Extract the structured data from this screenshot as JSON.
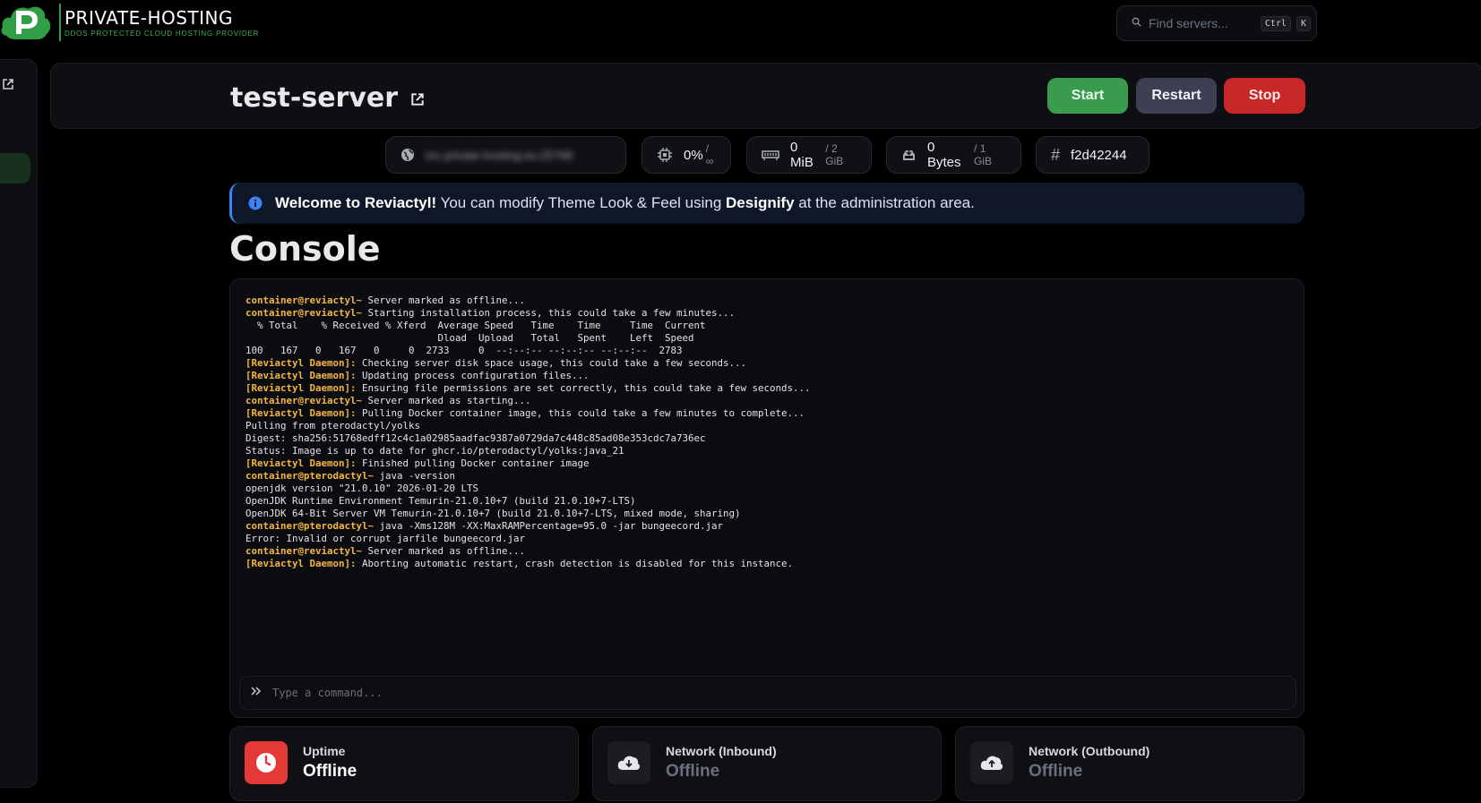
{
  "brand": {
    "title": "PRIVATE-HOSTING",
    "subtitle": "DDOS PROTECTED CLOUD HOSTING PROVIDER",
    "accent": "#2f9e44"
  },
  "search": {
    "placeholder": "Find servers...",
    "shortcut_ctrl": "Ctrl",
    "shortcut_key": "K"
  },
  "server": {
    "name": "test-server"
  },
  "controls": {
    "start": "Start",
    "restart": "Restart",
    "stop": "Stop"
  },
  "stats": {
    "address": "mc.private-hosting.eu:25768",
    "cpu": "0%",
    "cpu_limit": "/ ∞",
    "memory": "0 MiB",
    "memory_limit": "/ 2 GiB",
    "disk": "0 Bytes",
    "disk_limit": "/ 1 GiB",
    "id": "f2d42244"
  },
  "notice": {
    "lead": "Welcome to Reviactyl!",
    "text_1": " You can modify Theme Look & Feel using ",
    "highlight": "Designify",
    "text_2": " at the administration area."
  },
  "console": {
    "heading": "Console",
    "input_placeholder": "Type a command...",
    "lines": [
      {
        "prefix": "container@reviactyl~",
        "text": " Server marked as offline..."
      },
      {
        "prefix": "container@reviactyl~",
        "text": " Starting installation process, this could take a few minutes..."
      },
      {
        "prefix": "",
        "text": "  % Total    % Received % Xferd  Average Speed   Time    Time     Time  Current"
      },
      {
        "prefix": "",
        "text": "                                 Dload  Upload   Total   Spent    Left  Speed"
      },
      {
        "prefix": "",
        "text": "100   167   0   167   0     0  2733     0  --:--:-- --:--:-- --:--:--  2783"
      },
      {
        "prefix": "[Reviactyl Daemon]:",
        "text": " Checking server disk space usage, this could take a few seconds..."
      },
      {
        "prefix": "[Reviactyl Daemon]:",
        "text": " Updating process configuration files..."
      },
      {
        "prefix": "[Reviactyl Daemon]:",
        "text": " Ensuring file permissions are set correctly, this could take a few seconds..."
      },
      {
        "prefix": "container@reviactyl~",
        "text": " Server marked as starting..."
      },
      {
        "prefix": "[Reviactyl Daemon]:",
        "text": " Pulling Docker container image, this could take a few minutes to complete..."
      },
      {
        "prefix": "",
        "text": "Pulling from pterodactyl/yolks"
      },
      {
        "prefix": "",
        "text": "Digest: sha256:51768edff12c4c1a02985aadfac9387a0729da7c448c85ad08e353cdc7a736ec"
      },
      {
        "prefix": "",
        "text": "Status: Image is up to date for ghcr.io/pterodactyl/yolks:java_21"
      },
      {
        "prefix": "[Reviactyl Daemon]:",
        "text": " Finished pulling Docker container image"
      },
      {
        "prefix": "container@pterodactyl~",
        "text": " java -version"
      },
      {
        "prefix": "",
        "text": "openjdk version \"21.0.10\" 2026-01-20 LTS"
      },
      {
        "prefix": "",
        "text": "OpenJDK Runtime Environment Temurin-21.0.10+7 (build 21.0.10+7-LTS)"
      },
      {
        "prefix": "",
        "text": "OpenJDK 64-Bit Server VM Temurin-21.0.10+7 (build 21.0.10+7-LTS, mixed mode, sharing)"
      },
      {
        "prefix": "container@pterodactyl~",
        "text": " java -Xms128M -XX:MaxRAMPercentage=95.0 -jar bungeecord.jar"
      },
      {
        "prefix": "",
        "text": "Error: Invalid or corrupt jarfile bungeecord.jar"
      },
      {
        "prefix": "container@reviactyl~",
        "text": " Server marked as offline..."
      },
      {
        "prefix": "[Reviactyl Daemon]:",
        "text": " Aborting automatic restart, crash detection is disabled for this instance."
      }
    ]
  },
  "cards": [
    {
      "label": "Uptime",
      "value": "Offline",
      "icon": "clock-icon",
      "color": "#e53935"
    },
    {
      "label": "Network (Inbound)",
      "value": "Offline",
      "icon": "cloud-download-icon",
      "color": "#6b6e80"
    },
    {
      "label": "Network (Outbound)",
      "value": "Offline",
      "icon": "cloud-upload-icon",
      "color": "#6b6e80"
    }
  ]
}
